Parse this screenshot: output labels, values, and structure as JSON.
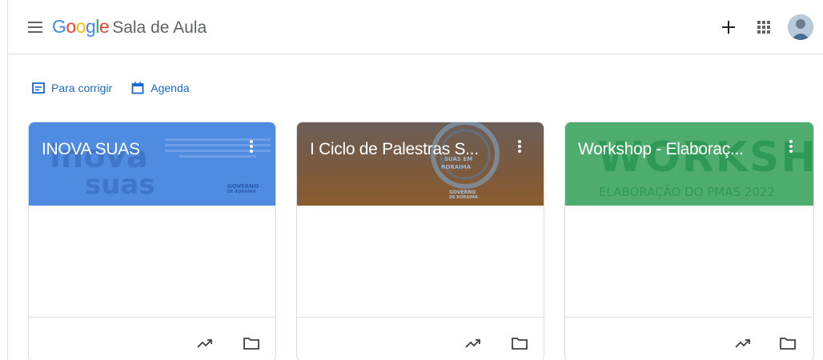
{
  "app": {
    "brand_google_letters": [
      "G",
      "o",
      "o",
      "g",
      "l",
      "e"
    ],
    "brand_name": "Sala de Aula",
    "icons": {
      "menu": "hamburger-menu-icon",
      "add": "plus-icon",
      "apps": "apps-grid-icon",
      "avatar": "user-avatar"
    }
  },
  "quicklinks": [
    {
      "label": "Para corrigir",
      "icon": "inbox-tray-icon"
    },
    {
      "label": "Agenda",
      "icon": "calendar-icon"
    }
  ],
  "cards": [
    {
      "title": "INOVA SUAS",
      "color": "#4f8be0",
      "banner_text": [
        "inova",
        "suas",
        "GOVERNO",
        "DE RORAIMA"
      ],
      "menu_icon": "more-vert-icon"
    },
    {
      "title": "I Ciclo de Palestras S...",
      "color": "#7b5a3f",
      "banner_text": [
        "SUAS EM",
        "RORAIMA",
        "GOVERNO",
        "DE RORAIMA"
      ],
      "menu_icon": "more-vert-icon"
    },
    {
      "title": "Workshop - Elaboraç...",
      "color": "#4fac6f",
      "banner_text": [
        "WORKSHO",
        "ELABORAÇÃO DO PMAS 2022"
      ],
      "menu_icon": "more-vert-icon"
    }
  ],
  "card_footer_icons": [
    "trending-up-icon",
    "folder-icon"
  ]
}
